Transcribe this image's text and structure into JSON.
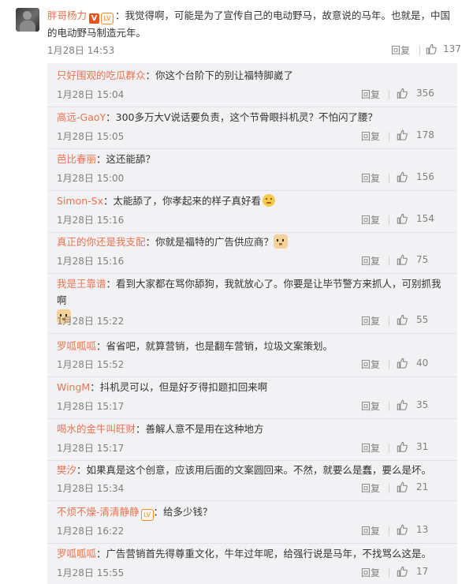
{
  "main_comment": {
    "username": "胖哥杨力",
    "v_badge": "V",
    "level_badge": "LV",
    "text": "：我觉得啊，可能是为了宣传自己的电动野马，故意说的马年。也就是，中国的电动野马制造元年。",
    "time": "1月28日 14:53",
    "reply_label": "回复",
    "likes": "137"
  },
  "replies": [
    {
      "name": "只好围观的吃瓜群众",
      "text": "：你这个台阶下的别让福特脚崴了",
      "time": "1月28日 15:04",
      "reply_label": "回复",
      "likes": "356"
    },
    {
      "name": "高远-GaoY",
      "text": "：300多万大V说话要负责，这个节骨眼抖机灵？不怕闪了腰？",
      "time": "1月28日 15:05",
      "reply_label": "回复",
      "likes": "178"
    },
    {
      "name": "芭比春丽",
      "text": "：这还能舔？",
      "time": "1月28日 15:00",
      "reply_label": "回复",
      "likes": "156"
    },
    {
      "name": "Simon-Sx",
      "text": "：太能舔了，你孝起来的样子真好看",
      "time": "1月28日 15:16",
      "reply_label": "回复",
      "likes": "154"
    },
    {
      "name": "真正的你还是我支配",
      "text": "：你就是福特的广告供应商？",
      "time": "1月28日 15:16",
      "reply_label": "回复",
      "likes": "75"
    },
    {
      "name": "我是王靠谱",
      "text": "：看到大家都在骂你舔狗，我就放心了。你要是让毕节警方来抓人，可别抓我啊",
      "time": "1月28日 15:22",
      "reply_label": "回复",
      "likes": "55"
    },
    {
      "name": "罗呱呱呱",
      "text": "：省省吧，就算营销，也是翻车营销，垃圾文案策划。",
      "time": "1月28日 15:52",
      "reply_label": "回复",
      "likes": "40"
    },
    {
      "name": "WingM",
      "text": "：抖机灵可以，但是好歹得扣题扣回来啊",
      "time": "1月28日 15:17",
      "reply_label": "回复",
      "likes": "35"
    },
    {
      "name": "喝水的金牛叫旺财",
      "text": "：善解人意不是用在这种地方",
      "time": "1月28日 15:17",
      "reply_label": "回复",
      "likes": "31"
    },
    {
      "name": "樊汐",
      "text": "：如果真是这个创意，应该用后面的文案圆回来。不然，就要么是蠢，要么是坏。",
      "time": "1月28日 15:34",
      "reply_label": "回复",
      "likes": "21"
    },
    {
      "name": "不烦不燥-清清静静",
      "text": "：给多少钱？",
      "time": "1月28日 16:22",
      "reply_label": "回复",
      "likes": "13"
    },
    {
      "name": "罗呱呱呱",
      "text": "：广告营销首先得尊重文化，牛年过年呢，给强行说是马年，不找骂么这是。",
      "time": "1月28日 15:55",
      "reply_label": "回复",
      "likes": "17"
    }
  ],
  "icons": {
    "like": "thumbs-up-icon",
    "emoji": "smile-emoji-icon",
    "doge": "doge-emoji-icon"
  },
  "colors": {
    "username": "#eb7350",
    "meta": "#808080",
    "panel": "#f2f2f5",
    "v_badge": "#e8541c"
  }
}
